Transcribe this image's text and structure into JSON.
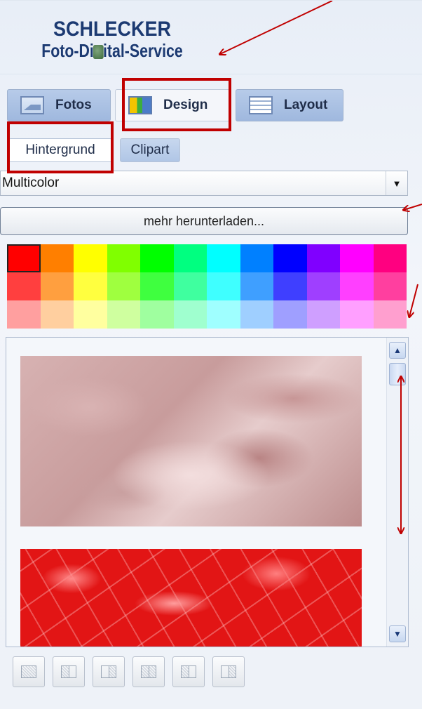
{
  "logo": {
    "line1": "SCHLECKER",
    "line2_a": "Foto-Di",
    "line2_b": "ital-Service"
  },
  "tabs": [
    {
      "label": "Fotos",
      "icon": "photo-icon",
      "state": "inactive"
    },
    {
      "label": "Design",
      "icon": "design-icon",
      "state": "active"
    },
    {
      "label": "Layout",
      "icon": "layout-icon",
      "state": "inactive"
    }
  ],
  "subtabs": [
    {
      "label": "Hintergrund",
      "state": "active"
    },
    {
      "label": "Clipart",
      "state": "inactive"
    }
  ],
  "category_select": {
    "value": "Multicolor"
  },
  "more_button": {
    "label": "mehr herunterladen..."
  },
  "color_palette": [
    [
      "#ff0000",
      "#ff7f00",
      "#ffff00",
      "#80ff00",
      "#00ff00",
      "#00ff80",
      "#00ffff",
      "#0080ff",
      "#0000ff",
      "#8000ff",
      "#ff00ff",
      "#ff0080"
    ],
    [
      "#ff3f3f",
      "#ff9f3f",
      "#ffff3f",
      "#9fff3f",
      "#3fff3f",
      "#3fff9f",
      "#3fffff",
      "#3f9fff",
      "#3f3fff",
      "#9f3fff",
      "#ff3fff",
      "#ff3f9f"
    ],
    [
      "#ff9f9f",
      "#ffcf9f",
      "#ffff9f",
      "#cfff9f",
      "#9fff9f",
      "#9fffcf",
      "#9fffff",
      "#9fcfff",
      "#9f9fff",
      "#cf9fff",
      "#ff9fff",
      "#ff9fcf"
    ]
  ],
  "selected_swatch": "#ff0000",
  "backgrounds": [
    {
      "name": "rose-marble-background"
    },
    {
      "name": "red-water-background"
    }
  ],
  "layout_buttons": [
    "layout-1",
    "layout-2",
    "layout-3",
    "layout-4",
    "layout-5",
    "layout-6"
  ],
  "annotation_color": "#c00000"
}
